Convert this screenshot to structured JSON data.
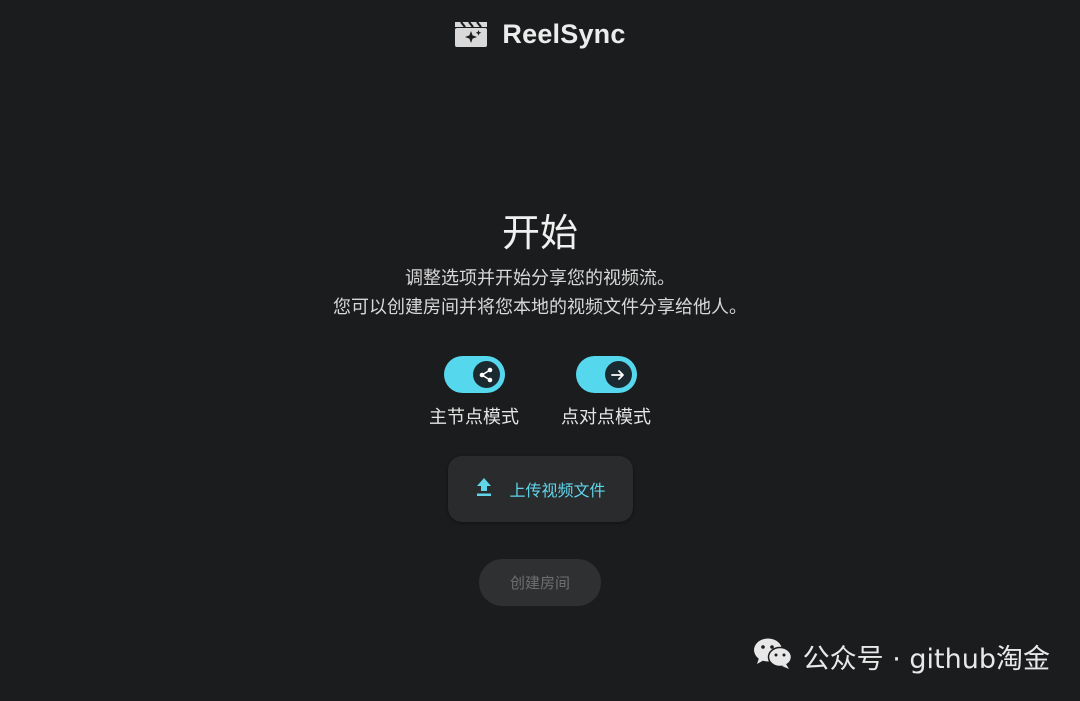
{
  "header": {
    "logo_icon": "clapperboard-sparkle-icon",
    "app_name": "ReelSync"
  },
  "main": {
    "title": "开始",
    "description_line1": "调整选项并开始分享您的视频流。",
    "description_line2": "您可以创建房间并将您本地的视频文件分享给他人。",
    "modes": [
      {
        "label": "主节点模式",
        "icon": "share-icon",
        "enabled": true
      },
      {
        "label": "点对点模式",
        "icon": "arrow-right-icon",
        "enabled": true
      }
    ],
    "upload_button_label": "上传视频文件",
    "upload_icon": "upload-icon",
    "create_room_label": "创建房间",
    "create_room_enabled": false
  },
  "watermark": {
    "text": "公众号 · github淘金",
    "icon": "wechat-icon"
  },
  "colors": {
    "background": "#1b1c1d",
    "accent": "#55d8ee",
    "button_bg": "#2a2b2d",
    "disabled_text": "#6e6f70"
  }
}
